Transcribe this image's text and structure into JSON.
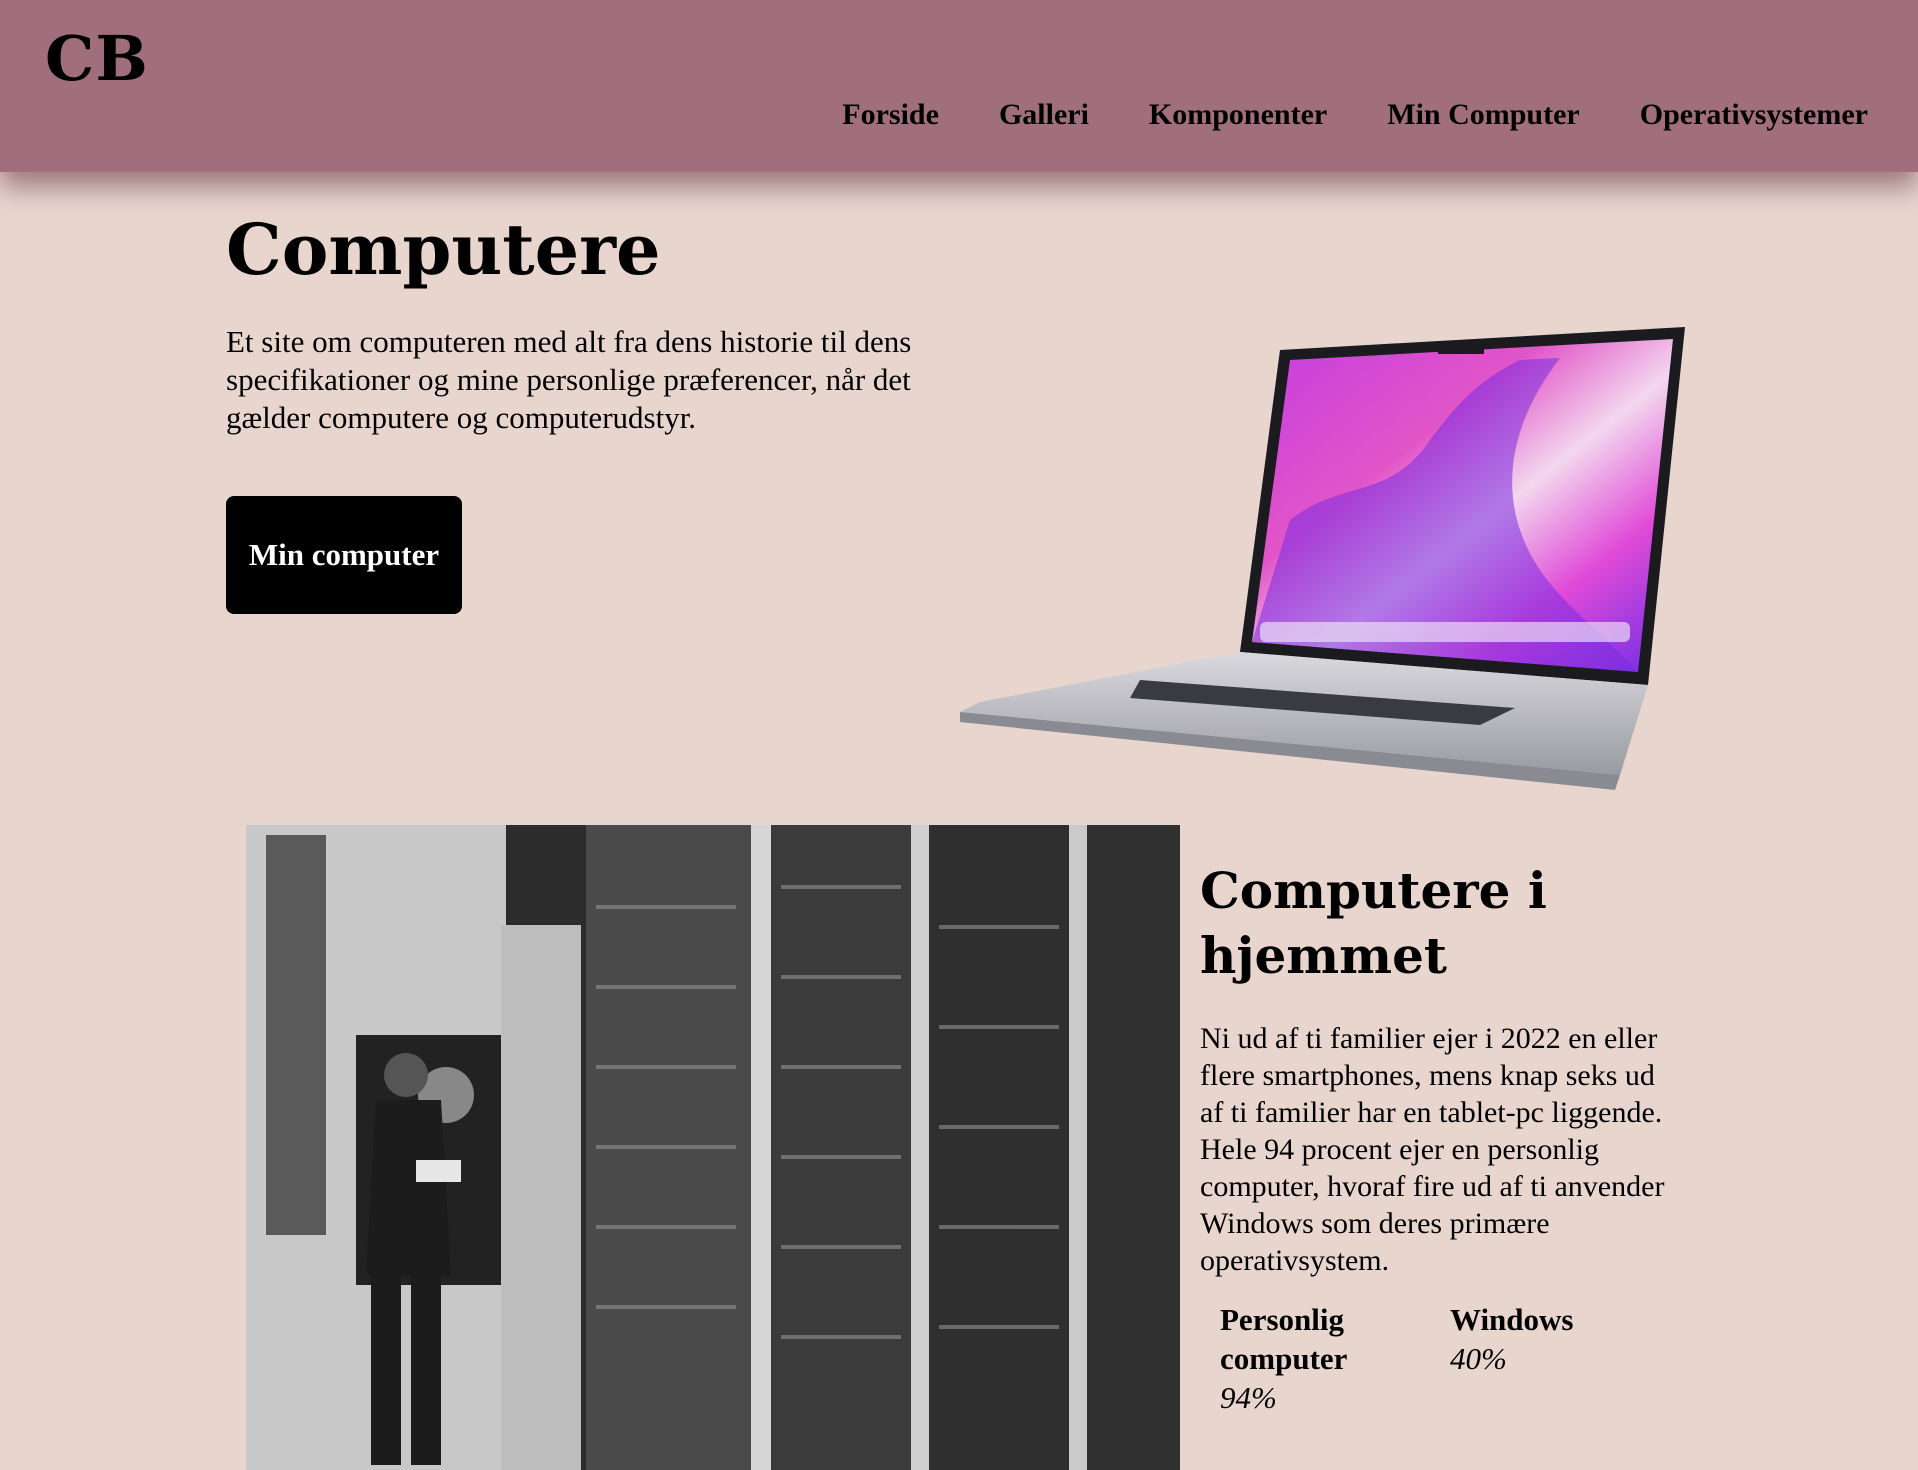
{
  "header": {
    "logo": "CB",
    "nav": [
      "Forside",
      "Galleri",
      "Komponenter",
      "Min Computer",
      "Operativsystemer"
    ]
  },
  "hero": {
    "title": "Computere",
    "text": "Et site om computeren med alt fra dens historie til dens specifikationer og mine personlige præferencer, når det gælder computere og computerudstyr.",
    "button": "Min computer"
  },
  "section": {
    "title": "Computere i hjemmet",
    "text": "Ni ud af ti familier ejer i 2022 en eller flere smartphones, mens knap seks ud af ti familier har en tablet-pc liggende. Hele 94 procent ejer en personlig computer, hvoraf fire ud af ti anvender Windows som deres primære operativsystem.",
    "stats": [
      {
        "label": "Personlig computer",
        "value": "94%"
      },
      {
        "label": "Windows",
        "value": "40%"
      }
    ]
  },
  "colors": {
    "header_bg": "#a06e7c",
    "page_bg": "#e8d5ce",
    "button_bg": "#000000"
  }
}
